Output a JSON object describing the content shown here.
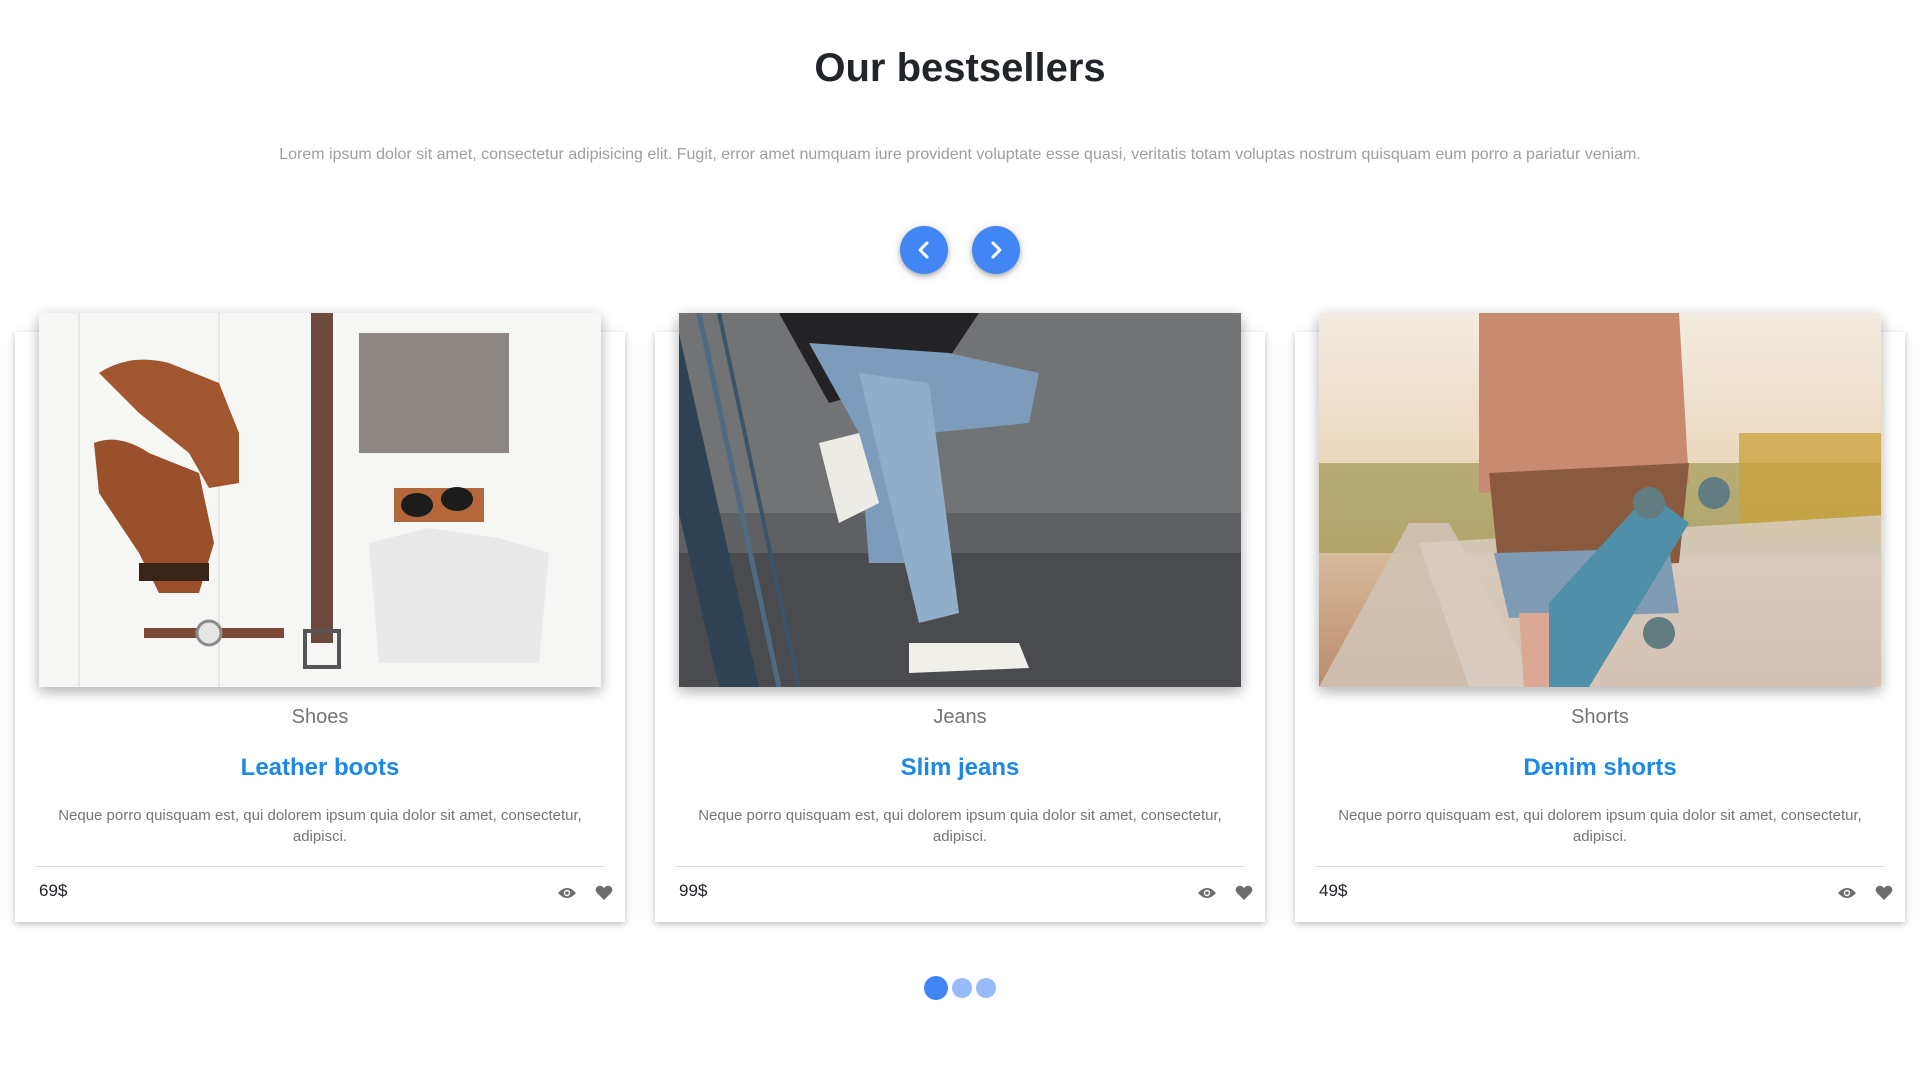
{
  "header": {
    "title": "Our bestsellers",
    "subtitle": "Lorem ipsum dolor sit amet, consectetur adipisicing elit. Fugit, error amet numquam iure provident voluptate esse quasi, veritatis totam voluptas nostrum quisquam eum porro a pariatur veniam."
  },
  "navigation": {
    "prev_icon": "chevron-left-icon",
    "next_icon": "chevron-right-icon"
  },
  "products": [
    {
      "category": "Shoes",
      "name": "Leather boots",
      "description": "Neque porro quisquam est, qui dolorem ipsum quia dolor sit amet, consectetur, adipisci.",
      "price": "69$"
    },
    {
      "category": "Jeans",
      "name": "Slim jeans",
      "description": "Neque porro quisquam est, qui dolorem ipsum quia dolor sit amet, consectetur, adipisci.",
      "price": "99$"
    },
    {
      "category": "Shorts",
      "name": "Denim shorts",
      "description": "Neque porro quisquam est, qui dolorem ipsum quia dolor sit amet, consectetur, adipisci.",
      "price": "49$"
    }
  ],
  "card_icons": [
    "eye-icon",
    "heart-icon"
  ],
  "pagination": {
    "pages": 3,
    "active_index": 0
  },
  "colors": {
    "accent": "#4285f4",
    "product_title": "#1e88e5",
    "muted_text": "#757575"
  }
}
